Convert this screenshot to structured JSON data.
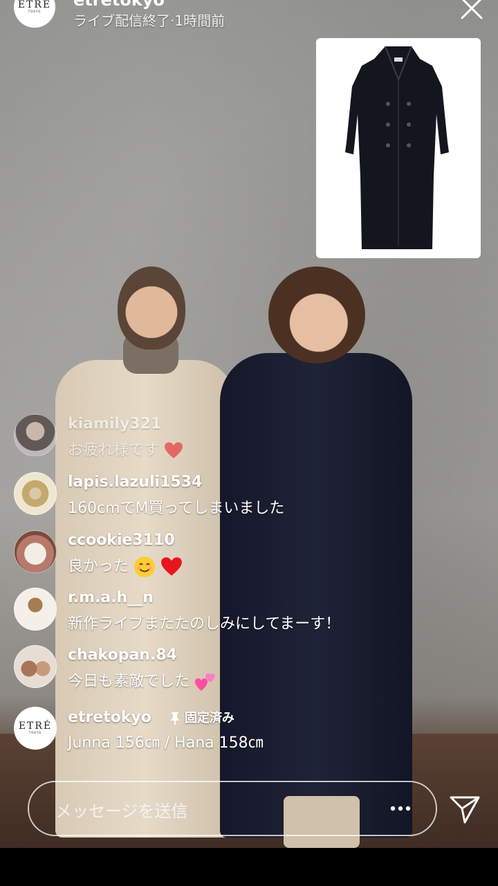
{
  "header": {
    "account": "etretokyo",
    "status": "ライブ配信終了·1時間前"
  },
  "brand_logo": {
    "text": "ETRÉ",
    "sub": "TOKYO"
  },
  "product": {
    "image_name": "black-long-coat"
  },
  "comments": [
    {
      "user": "kiamily321",
      "text": "お疲れ様です",
      "emoji": "red-heart",
      "faded": true
    },
    {
      "user": "lapis.lazuli1534",
      "text": "160cmでM買ってしまいました"
    },
    {
      "user": "ccookie3110",
      "text": "良かった",
      "emoji": "smile-face red-heart"
    },
    {
      "user": "r.m.a.h__n",
      "text": "新作ライブまたたのしみにしてまーす！"
    },
    {
      "user": "chakopan.84",
      "text": "今日も素敵でした",
      "emoji": "two-hearts"
    }
  ],
  "pinned": {
    "user": "etretokyo",
    "pin_label": "固定済み",
    "text": "Junna 156㎝ / Hana 158㎝"
  },
  "composer": {
    "placeholder": "メッセージを送信"
  },
  "icons": {
    "close": "close-icon",
    "more": "more-dots-icon",
    "send": "send-icon",
    "pin": "pin-icon"
  }
}
